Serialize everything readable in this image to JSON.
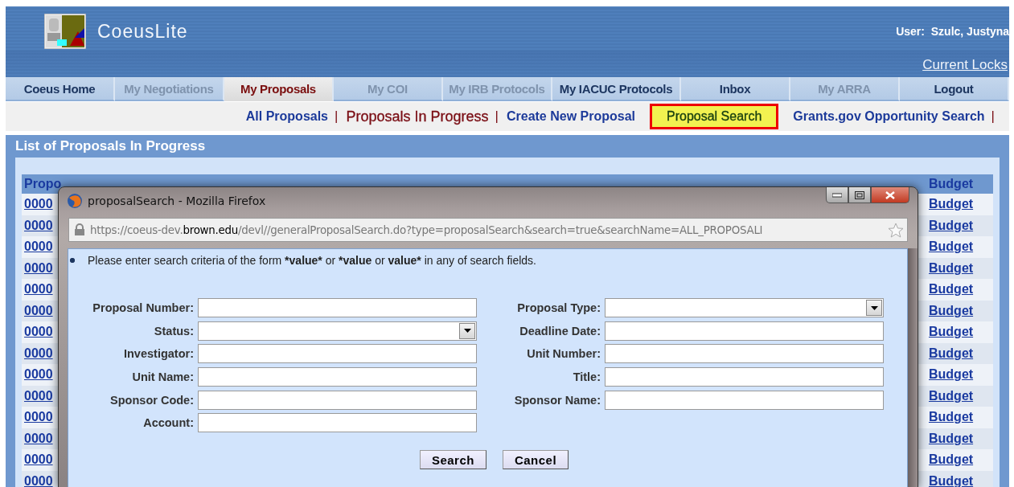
{
  "header": {
    "app_name": "CoeusLite",
    "user": "User:  Szulc, Justyna",
    "current_locks": "Current Locks"
  },
  "nav_tabs": [
    {
      "label": "Coeus Home",
      "selected": false,
      "disabled": false
    },
    {
      "label": "My Negotiations",
      "selected": false,
      "disabled": true
    },
    {
      "label": "My Proposals",
      "selected": true,
      "disabled": false
    },
    {
      "label": "My COI",
      "selected": false,
      "disabled": true
    },
    {
      "label": "My IRB Protocols",
      "selected": false,
      "disabled": true
    },
    {
      "label": "My IACUC Protocols",
      "selected": false,
      "disabled": false
    },
    {
      "label": "Inbox",
      "selected": false,
      "disabled": false
    },
    {
      "label": "My ARRA",
      "selected": false,
      "disabled": true
    },
    {
      "label": "Logout",
      "selected": false,
      "disabled": false
    }
  ],
  "sub_nav": [
    {
      "label": "All Proposals",
      "kind": "link",
      "separator": "|"
    },
    {
      "label": "Proposals In Progress",
      "kind": "current",
      "separator": "|"
    },
    {
      "label": "Create New Proposal",
      "kind": "link"
    },
    {
      "label": "Proposal Search",
      "kind": "highlighted"
    },
    {
      "label": "Grants.gov Opportunity Search",
      "kind": "link",
      "separator": "|"
    }
  ],
  "list_panel": {
    "title": "List of Proposals In Progress",
    "columns": [
      "Propo",
      "Budget"
    ],
    "rows": [
      {
        "number": "0000",
        "budget": "Budget"
      },
      {
        "number": "0000",
        "budget": "Budget"
      },
      {
        "number": "0000",
        "budget": "Budget"
      },
      {
        "number": "0000",
        "budget": "Budget"
      },
      {
        "number": "0000",
        "budget": "Budget"
      },
      {
        "number": "0000",
        "budget": "Budget"
      },
      {
        "number": "0000",
        "budget": "Budget"
      },
      {
        "number": "0000",
        "budget": "Budget"
      },
      {
        "number": "0000",
        "budget": "Budget"
      },
      {
        "number": "0000",
        "budget": "Budget"
      },
      {
        "number": "0000",
        "budget": "Budget"
      },
      {
        "number": "0000",
        "budget": "Budget"
      },
      {
        "number": "0000",
        "budget": "Budget"
      },
      {
        "number": "0000",
        "budget": "Budget"
      }
    ]
  },
  "popup_window": {
    "title": "proposalSearch - Mozilla Firefox",
    "url": "https://coeus-dev.**brown.edu**/devl//generalProposalSearch.do?type=proposalSearch&search=true&searchName=ALL_PROPOSALI",
    "note": [
      {
        "text": "Please enter search criteria of the form ",
        "bold": false
      },
      {
        "text": "*value*",
        "bold": true
      },
      {
        "text": " or ",
        "bold": false
      },
      {
        "text": "*value",
        "bold": true
      },
      {
        "text": " or ",
        "bold": false
      },
      {
        "text": "value*",
        "bold": true
      },
      {
        "text": " in any of search fields.",
        "bold": false
      }
    ],
    "fields_left": [
      {
        "label": "Proposal Number:",
        "kind": "text"
      },
      {
        "label": "Status:",
        "kind": "select"
      },
      {
        "label": "Investigator:",
        "kind": "text"
      },
      {
        "label": "Unit Name:",
        "kind": "text"
      },
      {
        "label": "Sponsor Code:",
        "kind": "text"
      },
      {
        "label": "Account:",
        "kind": "text"
      }
    ],
    "fields_right": [
      {
        "label": "Proposal Type:",
        "kind": "select"
      },
      {
        "label": "Deadline Date:",
        "kind": "text"
      },
      {
        "label": "Unit Number:",
        "kind": "text"
      },
      {
        "label": "Title:",
        "kind": "text"
      },
      {
        "label": "Sponsor Name:",
        "kind": "text"
      }
    ],
    "buttons": [
      "Search",
      "Cancel"
    ]
  }
}
